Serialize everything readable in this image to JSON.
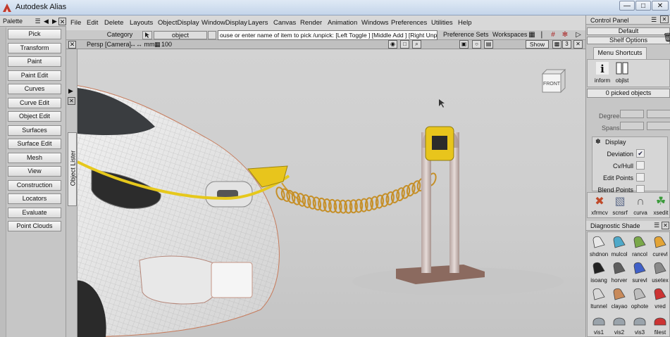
{
  "window": {
    "title": "Autodesk Alias",
    "controls": [
      "minimize",
      "restore",
      "close"
    ]
  },
  "palette": {
    "title": "Palette",
    "items": [
      "Pick",
      "Transform",
      "Paint",
      "Paint Edit",
      "Curves",
      "Curve Edit",
      "Object Edit",
      "Surfaces",
      "Surface Edit",
      "Mesh",
      "View",
      "Construction",
      "Locators",
      "Evaluate",
      "Point Clouds"
    ]
  },
  "object_lister": {
    "label": "Object Lister"
  },
  "menubar": {
    "items": [
      "File",
      "Edit",
      "Delete",
      "Layouts",
      "ObjectDisplay",
      "WindowDisplay",
      "Layers",
      "Canvas",
      "Render",
      "Animation",
      "Windows",
      "Preferences",
      "Utilities",
      "Help"
    ]
  },
  "toolbar": {
    "category": "Category",
    "object": "object",
    "prompt": "ouse or enter name of item to pick /unpick: [Left Toggle ] [Middle Add ] [Right Unpick ]",
    "preference_sets": "Preference Sets",
    "workspaces": "Workspaces"
  },
  "viewport": {
    "title": "Persp [Camera]",
    "units": "↔↔ mm",
    "scale": "100",
    "show_button": "Show",
    "frame_number": "3",
    "viewcube_face": "FRONT"
  },
  "control_panel": {
    "title": "Control Panel",
    "default_label": "Default",
    "shelf_options": "Shelf Options",
    "menu_shortcuts_tab": "Menu Shortcuts",
    "shortcuts": [
      {
        "label": "inform",
        "icon": "info-icon"
      },
      {
        "label": "objlst",
        "icon": "object-list-icon"
      }
    ],
    "picked_objects": "0 picked objects",
    "degree_label": "Degree",
    "spans_label": "Spans",
    "display_section": "Display",
    "display_options": [
      {
        "label": "Deviation",
        "checked": true
      },
      {
        "label": "Cv/Hull",
        "checked": false
      },
      {
        "label": "Edit Points",
        "checked": false
      },
      {
        "label": "Blend Points",
        "checked": false
      }
    ],
    "tool_shelf": [
      {
        "label": "xfrmcv",
        "icon": "transform-cv-icon"
      },
      {
        "label": "scnsrf",
        "icon": "scan-surface-icon"
      },
      {
        "label": "curva",
        "icon": "curvature-icon"
      },
      {
        "label": "xsedit",
        "icon": "xsection-edit-icon"
      }
    ],
    "diagnostic_title": "Diagnostic Shade",
    "diagnostic_shelf": [
      {
        "label": "shdnon",
        "color": "#e8e8e8"
      },
      {
        "label": "mulcol",
        "color": "#4fa9c9"
      },
      {
        "label": "rancol",
        "color": "#7aa84a"
      },
      {
        "label": "curevl",
        "color": "#e3a436"
      },
      {
        "label": "isoang",
        "color": "#222222"
      },
      {
        "label": "horver",
        "color": "#5e5e5e"
      },
      {
        "label": "surevl",
        "color": "#4060c8"
      },
      {
        "label": "usetex",
        "color": "#8a8a8a"
      },
      {
        "label": "ltunnel",
        "color": "#d8d8d8"
      },
      {
        "label": "clayao",
        "color": "#c88a5a"
      },
      {
        "label": "ophote",
        "color": "#bdbdbd"
      },
      {
        "label": "vred",
        "color": "#cc3333"
      },
      {
        "label": "vis1",
        "color": "#9aa3ab"
      },
      {
        "label": "vis2",
        "color": "#9aa3ab"
      },
      {
        "label": "vis3",
        "color": "#9aa3ab"
      },
      {
        "label": "filest",
        "color": "#cc3333"
      }
    ]
  }
}
